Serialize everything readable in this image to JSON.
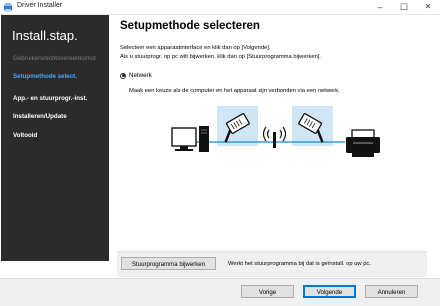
{
  "window": {
    "title": "Driver Installer",
    "minimize_icon": "minimize-icon",
    "maximize_icon": "maximize-icon",
    "close_icon": "close-icon"
  },
  "sidebar": {
    "title": "Install.stap.",
    "steps": [
      {
        "label": "Gebruikersrechtovereenkomst",
        "state": "done"
      },
      {
        "label": "Setupmethode select.",
        "state": "active"
      },
      {
        "label": "App.- en stuurprogr.-inst.",
        "state": "pending"
      },
      {
        "label": "Installeren/Update",
        "state": "pending"
      },
      {
        "label": "Voltooid",
        "state": "pending"
      }
    ],
    "active_color": "#4aa8ff"
  },
  "main": {
    "title": "Setupmethode selecteren",
    "desc_line1": "Selecteer een apparaatinterface en klik dan op [Volgende].",
    "desc_line2": "Als u stuurprogr. op pc wilt bijwerken, klik dan op [Stuurprogramma bijwerken].",
    "option_label": "Netwerk",
    "option_selected": true,
    "option_desc": "Maak een keuze als de computer en het apparaat zijn verbonden via een netwerk.",
    "diagram_icons": [
      "computer-icon",
      "network-cable-icon",
      "wireless-access-point-icon",
      "network-cable-icon",
      "printer-icon"
    ],
    "update_button_label": "Stuurprogramma bijwerken",
    "update_desc": "Werkt het stuurprogramma bij dat is geïnstall. op uw pc."
  },
  "footer": {
    "back_label": "Vorige",
    "next_label": "Volgende",
    "cancel_label": "Annuleren"
  },
  "colors": {
    "sidebar_bg": "#2b2b2b",
    "accent": "#0078d7",
    "diagram_highlight": "#cfe6f7"
  }
}
